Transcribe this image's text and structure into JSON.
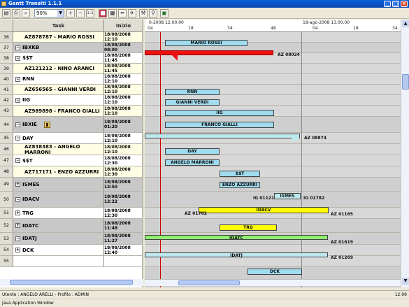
{
  "window": {
    "title": "Gantt Transiti 1.1.1",
    "minimize": "_",
    "maximize": "□",
    "close": "×"
  },
  "toolbar": {
    "zoom_value": "90%",
    "zoom_in": "+",
    "zoom_out": "−",
    "zoom_reset": "1:1"
  },
  "table": {
    "col_task": "Task",
    "col_start": "Inizio"
  },
  "timeline": {
    "date_left": "0-2008 12.00.00",
    "date_right": "18-ago-2008 13.00.00",
    "ticks": [
      "04",
      "18",
      "34",
      "48",
      "04",
      "18",
      "34"
    ]
  },
  "rows": [
    {
      "num": "36",
      "task": "AZ878787 - MARIO ROSSI",
      "start": "18/08/2008 12:10",
      "shade": "#fffde4"
    },
    {
      "num": "37",
      "task": "IBXKB",
      "start": "18/08/2008 08:00",
      "shade": "#c8c8c8",
      "exp": "⊟"
    },
    {
      "num": "38",
      "task": "$$T",
      "start": "18/08/2008 11:45",
      "shade": "#ffffff",
      "exp": "⊟"
    },
    {
      "num": "39",
      "task": "AZ121212 - NINO ARANCI",
      "start": "18/08/2008 11:45",
      "shade": "#fffde4"
    },
    {
      "num": "40",
      "task": "RNN",
      "start": "18/08/2008 12:10",
      "shade": "#ffffff",
      "exp": "⊟"
    },
    {
      "num": "41",
      "task": "AZ656565 - GIANNI VERDI",
      "start": "18/08/2008 12:10",
      "shade": "#fffde4"
    },
    {
      "num": "42",
      "task": "IIG",
      "start": "18/08/2008 12:10",
      "shade": "#ffffff",
      "exp": "⊟"
    },
    {
      "num": "43",
      "task": "AZ989898 - FRANCO GIALLI",
      "start": "18/08/2008 12:10",
      "shade": "#fffde4"
    },
    {
      "num": "44",
      "task": "IBXIE",
      "start": "18/08/2008 01:20",
      "shade": "#c8c8c8",
      "exp": "⊟",
      "flag": true
    },
    {
      "num": "45",
      "task": "DAY",
      "start": "18/08/2008 12:10",
      "shade": "#ffffff",
      "exp": "⊟"
    },
    {
      "num": "46",
      "task": "AZ838383 - ANGELO MARRONI",
      "start": "18/08/2008 12:10",
      "shade": "#fffde4"
    },
    {
      "num": "47",
      "task": "$$T",
      "start": "18/08/2008 12:30",
      "shade": "#ffffff",
      "exp": "⊟"
    },
    {
      "num": "48",
      "task": "AZ717171 - ENZO AZZURRI",
      "start": "18/08/2008 12:30",
      "shade": "#fffde4"
    },
    {
      "num": "49",
      "task": "ISMES",
      "start": "18/08/2008 12:50",
      "shade": "#c8c8c8",
      "exp": "⊞"
    },
    {
      "num": "50",
      "task": "IDACV",
      "start": "18/08/2008 12:22",
      "shade": "#c8c8c8",
      "exp": "⊟"
    },
    {
      "num": "51",
      "task": "TRG",
      "start": "18/08/2008 12:30",
      "shade": "#ffffff",
      "exp": "⊞"
    },
    {
      "num": "52",
      "task": "IDATC",
      "start": "18/08/2008 11:48",
      "shade": "#c8c8c8",
      "exp": "⊞"
    },
    {
      "num": "53",
      "task": "IDATJ",
      "start": "18/08/2008 11:27",
      "shade": "#c8c8c8",
      "exp": "⊟"
    },
    {
      "num": "54",
      "task": "DCK",
      "start": "18/08/2008 12:40",
      "shade": "#ffffff",
      "exp": "⊞"
    },
    {
      "num": "55",
      "task": "",
      "start": "",
      "shade": "#ffffff"
    }
  ],
  "bars": {
    "b36": "MARIO ROSSI",
    "b37_out": "AZ 08024",
    "b40": "RNN",
    "b41": "GIANNI VERDI",
    "b42": "IIG",
    "b43": "FRANCO GIALLI",
    "b44_out": "AZ 08874",
    "b45": "DAY",
    "b46": "ANGELO MARRONI",
    "b47": "$$T",
    "b48": "ENZO AZZURRI",
    "b49": "ISMES",
    "b49_l": "IG 01121",
    "b49_r": "IG 01782",
    "b50": "IDACV",
    "b50_l": "AZ 01782",
    "b50_r": "AZ 01165",
    "b51": "TRG",
    "b52": "IDATC",
    "b52_r": "AZ 01619",
    "b53": "IDATJ",
    "b53_r": "AZ 01269",
    "b54": "DCK"
  },
  "status": {
    "user": "Utente : ANGELO ARELLI - Profilo : ADMIN",
    "clock": "12:09"
  },
  "taskbar": {
    "label": "Java Application Window"
  },
  "colors": {
    "grey_bar": "#bde8ee",
    "red_bar": "#ee1111",
    "yellow_bar": "#ffff00",
    "green_bar": "#90ee70",
    "blue_bar": "#9fdcf0",
    "now_line": "#d00000"
  }
}
